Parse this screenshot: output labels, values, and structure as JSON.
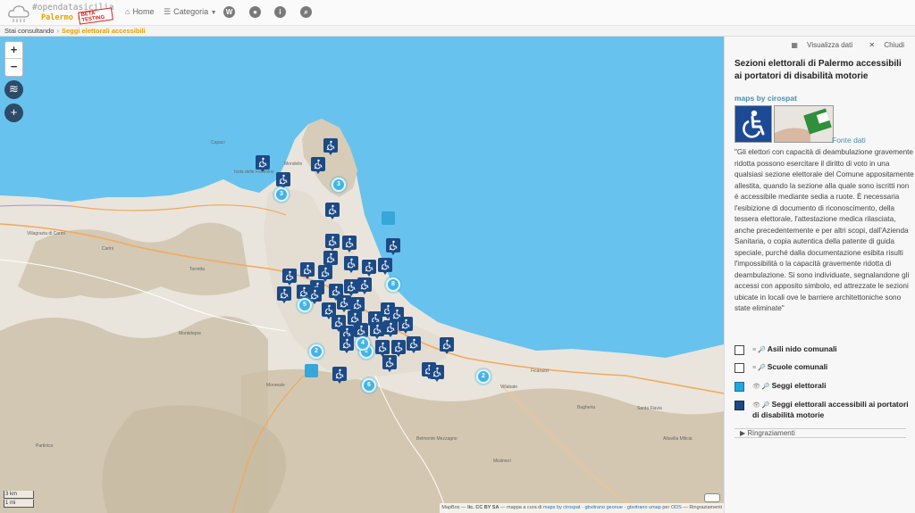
{
  "brand": {
    "hashtag": "#opendatasicilia",
    "city": "Palermo Hub",
    "beta": "BETA TESTING"
  },
  "nav": {
    "home": "Home",
    "category": "Categoria",
    "icons": [
      "wordpress-icon",
      "github-icon",
      "info-icon",
      "search-icon"
    ]
  },
  "breadcrumb": {
    "label": "Stai consultando",
    "current": "Seggi elettorali accessibili"
  },
  "map": {
    "zoom_in": "+",
    "zoom_out": "−",
    "add": "+",
    "place_labels": [
      "Capaci",
      "Isola delle Femmine",
      "Carini",
      "Villagrazia di Carini",
      "Torretta",
      "Montelepre",
      "Monreale",
      "Partinico",
      "Belmonte Mezzagno",
      "Misilmeri",
      "Villabate",
      "Bagheria",
      "Ficarazzi",
      "Altavilla Milicia",
      "Santa Flavia",
      "Mondello"
    ],
    "clusters": [
      "3",
      "3",
      "5",
      "8",
      "2",
      "2",
      "6",
      "2",
      "4"
    ],
    "scale_km": "3 km",
    "scale_mi": "1 mi",
    "attribution": {
      "provider": "MapBox",
      "license": "lic. CC BY SA",
      "credit": "mappa a cura di",
      "author": "maps by cirospat",
      "sep1": "·",
      "link1": "gbvitrano geonue",
      "sep2": "·",
      "link2": "gbvitrano umap",
      "per": "per",
      "ods": "ODS",
      "thanks": "Ringraziamenti"
    }
  },
  "panel": {
    "view_data": "Visualizza dati",
    "close": "Chiudi",
    "title": "Sezioni elettorali di Palermo accessibili ai portatori di disabilità motorie",
    "maps_by": "maps by cirospat",
    "fonte": "Fonte dati",
    "description": "\"Gli elettori con capacità di deambulazione gravemente ridotta possono esercitare il diritto di voto in una qualsiasi sezione elettorale del Comune appositamente allestita, quando la sezione alla quale sono iscritti non è accessibile mediante sedia a ruote. È necessaria l'esibizione di documento di riconoscimento, della tessera elettorale, l'attestazione medica rilasciata, anche precedentemente e per altri scopi, dall'Azienda Sanitaria, o copia autentica della patente di guida speciale, purché dalla documentazione esibita risulti l'impossibilità o la capacità gravemente ridotta di deambulazione. Si sono individuate, segnalandone gli accessi con apposito simbolo, ed attrezzate le sezioni ubicate in locali ove le barriere architettoniche sono state eliminate\"",
    "layers": [
      {
        "label": "Asili nido comunali",
        "color": "#ffffff",
        "on": false
      },
      {
        "label": "Scuole comunali",
        "color": "#ffffff",
        "on": false
      },
      {
        "label": "Seggi elettorali",
        "color": "#1fa7e0",
        "on": true
      },
      {
        "label": "Seggi elettorali accessibili ai portatori di disabilità motorie",
        "color": "#1c4a86",
        "on": true
      }
    ],
    "thanks": "Ringraziamenti"
  },
  "colors": {
    "accent": "#e8a100",
    "link": "#4a8fb1",
    "sea": "#67c2ee",
    "pin": "#1c4a86",
    "cluster": "#44b4e6"
  }
}
